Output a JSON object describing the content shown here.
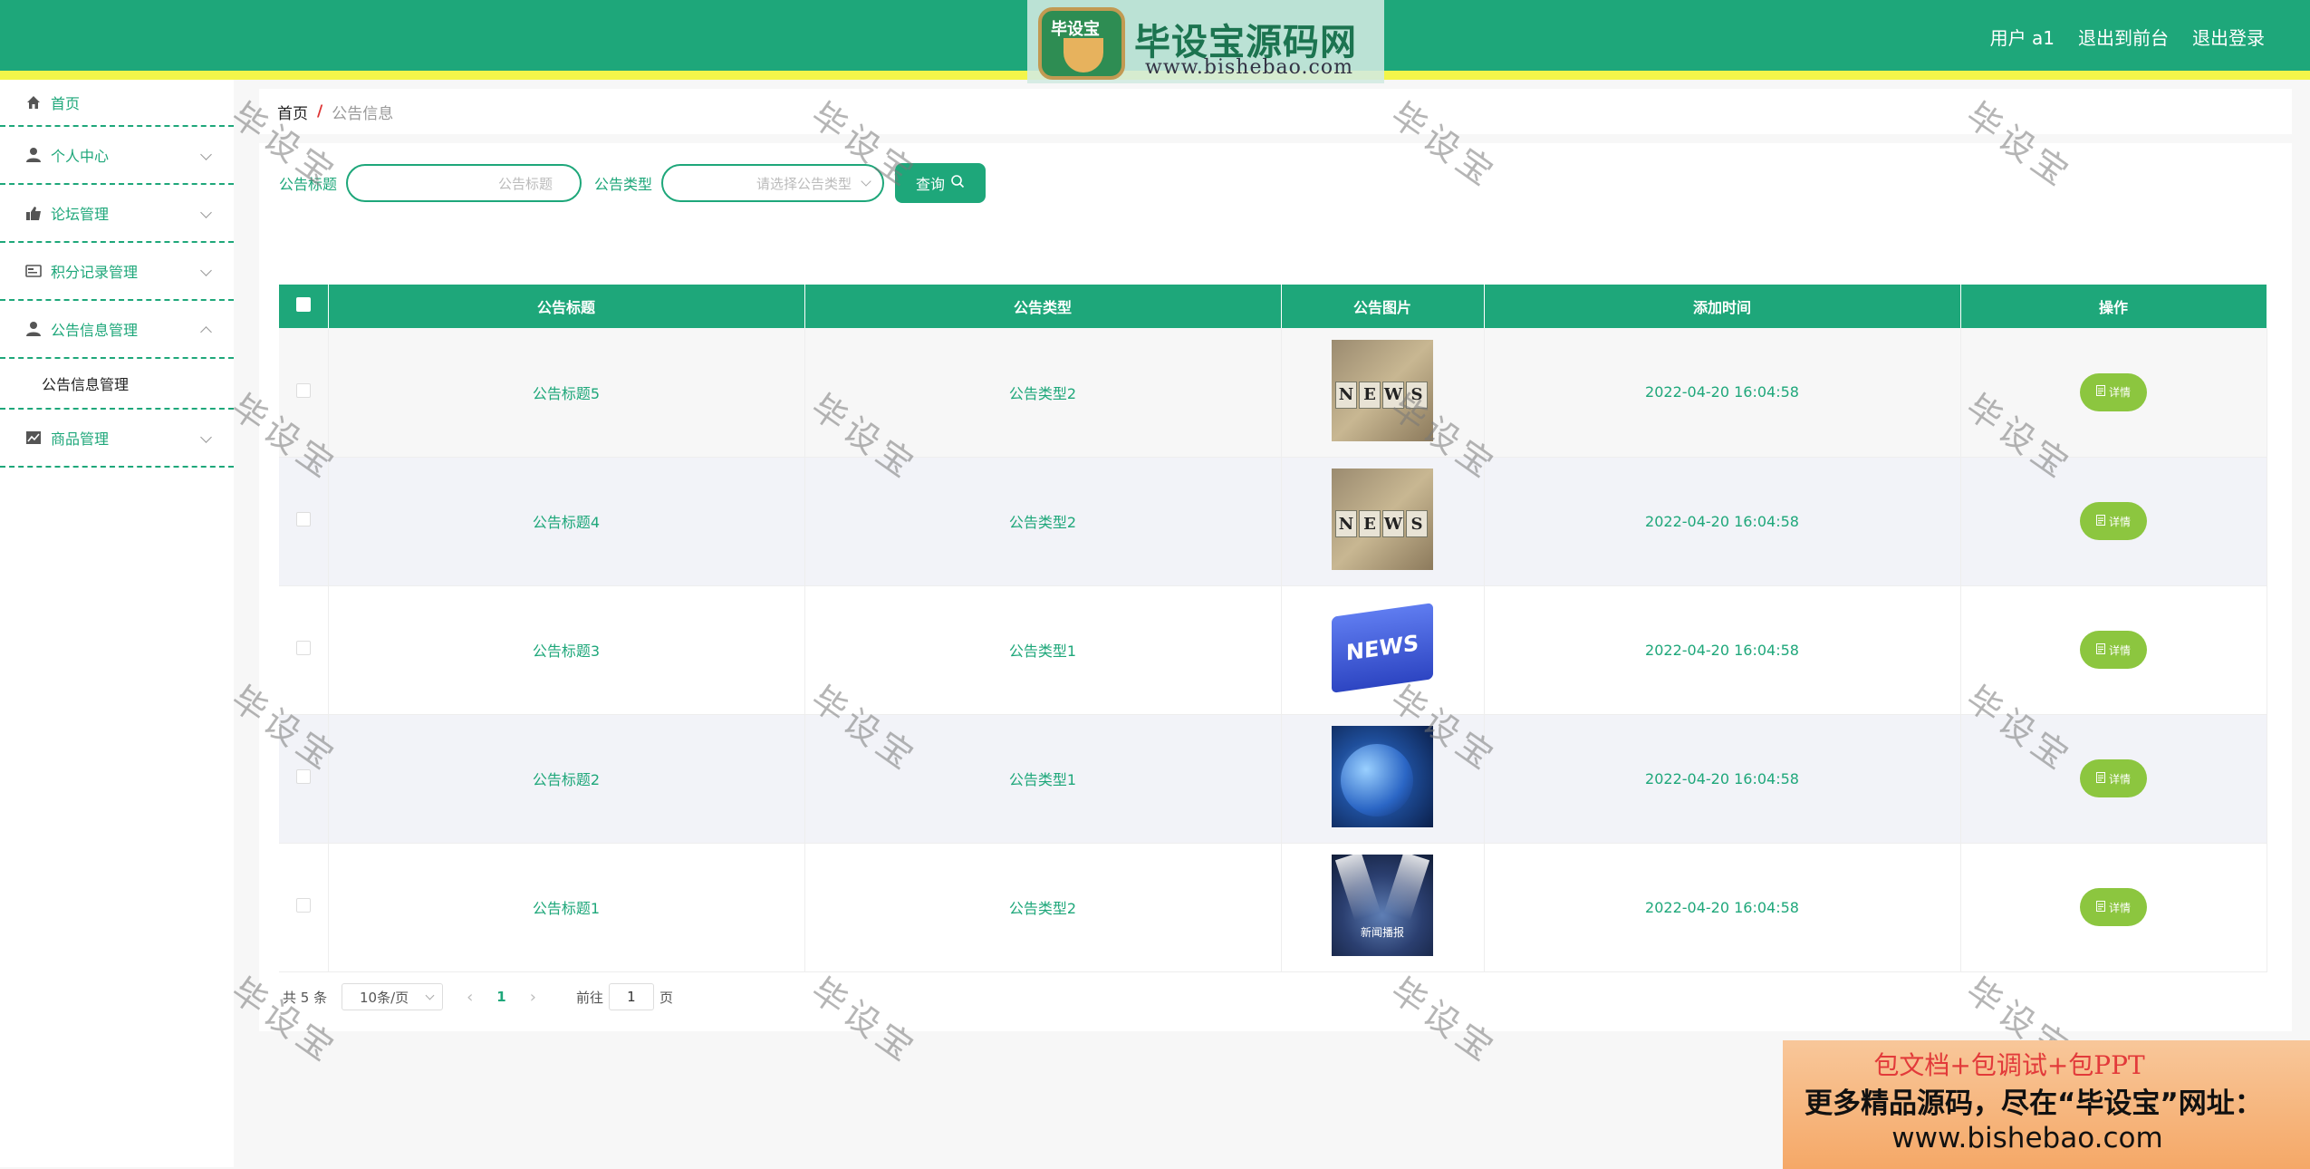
{
  "header": {
    "brand_cup_label": "毕设宝",
    "brand_title": "毕设宝源码网",
    "brand_url": "www.bishebao.com",
    "user": "用户 a1",
    "to_front": "退出到前台",
    "logout": "退出登录",
    "colors": {
      "primary": "#1ea77a",
      "accent_bar": "#f3f54a"
    }
  },
  "sidebar": {
    "home": {
      "label": "首页",
      "icon": "home-icon"
    },
    "items": [
      {
        "label": "个人中心",
        "icon": "user-icon",
        "expanded": false
      },
      {
        "label": "论坛管理",
        "icon": "forum-icon",
        "expanded": false
      },
      {
        "label": "积分记录管理",
        "icon": "card-icon",
        "expanded": false
      },
      {
        "label": "公告信息管理",
        "icon": "user-icon",
        "expanded": true
      },
      {
        "label": "商品管理",
        "icon": "chart-icon",
        "expanded": false
      }
    ],
    "submenu": {
      "label": "公告信息管理"
    }
  },
  "breadcrumb": {
    "home": "首页",
    "sep": "/",
    "current": "公告信息"
  },
  "search": {
    "title_label": "公告标题",
    "title_placeholder": "公告标题",
    "type_label": "公告类型",
    "type_placeholder": "请选择公告类型",
    "query_button": "查询"
  },
  "table": {
    "headers": [
      "公告标题",
      "公告类型",
      "公告图片",
      "添加时间",
      "操作"
    ],
    "rows": [
      {
        "title": "公告标题5",
        "type": "公告类型2",
        "image": "news-cubes",
        "time": "2022-04-20 16:04:58",
        "action": "详情"
      },
      {
        "title": "公告标题4",
        "type": "公告类型2",
        "image": "news-cubes",
        "time": "2022-04-20 16:04:58",
        "action": "详情"
      },
      {
        "title": "公告标题3",
        "type": "公告类型1",
        "image": "news-key",
        "time": "2022-04-20 16:04:58",
        "action": "详情"
      },
      {
        "title": "公告标题2",
        "type": "公告类型1",
        "image": "globe",
        "time": "2022-04-20 16:04:58",
        "action": "详情"
      },
      {
        "title": "公告标题1",
        "type": "公告类型2",
        "image": "spotlight",
        "time": "2022-04-20 16:04:58",
        "action": "详情"
      }
    ],
    "image_texts": {
      "cubes": [
        "N",
        "E",
        "W",
        "S"
      ],
      "key": "NEWS",
      "spotlight": "新闻播报"
    }
  },
  "pagination": {
    "total": "共 5 条",
    "page_size": "10条/页",
    "current_page": "1",
    "goto_prefix": "前往",
    "goto_value": "1",
    "goto_suffix": "页"
  },
  "watermark": "毕设宝",
  "ad": {
    "line1": "包文档+包调试+包PPT",
    "line2": "更多精品源码，尽在“毕设宝”网址：",
    "line3": "www.bishebao.com"
  }
}
